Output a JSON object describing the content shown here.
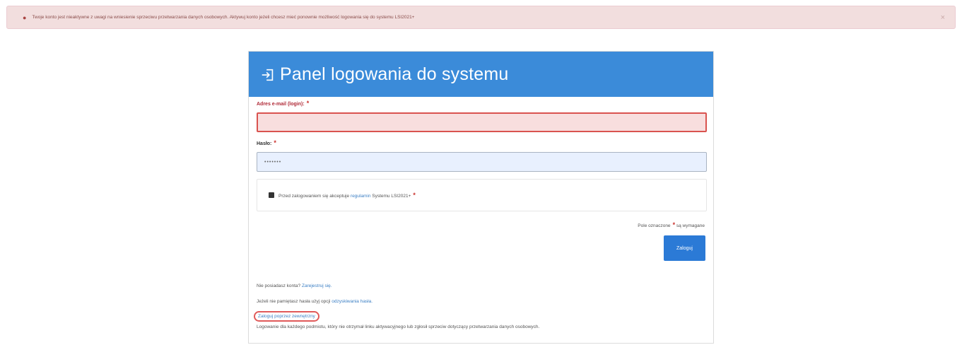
{
  "alert": {
    "message": "Twoje konto jest nieaktywne z uwagi na wniesienie sprzeciwu przetwarzania danych osobowych. Aktywuj konto jeżeli chcesz mieć ponownie możliwość logowania się do systemu LSI2021+",
    "close_symbol": "×"
  },
  "panel": {
    "title": "Panel logowania do systemu",
    "email": {
      "label": "Adres e-mail (login):",
      "value": ""
    },
    "password": {
      "label": "Hasło:",
      "value": "•••••••"
    },
    "consent": {
      "text_before": "Przed zalogowaniem się akceptuje",
      "link": "regulamin",
      "text_after": "Systemu LSI2021+"
    },
    "required_note": {
      "field": "Pole oznaczone",
      "text": "są wymagane"
    },
    "submit_label": "Zaloguj",
    "no_account": {
      "text": "Nie posiadasz konta?",
      "link": "Zarejestruj się."
    },
    "forgot": {
      "text": "Jeżeli nie pamiętasz hasła użyj opcji",
      "link": "odzyskiwania hasła."
    },
    "external_login": {
      "link": "Zaloguj poprzez zewnętrzny",
      "description": "Logowanie dla każdego podmiotu, który nie otrzymał linku aktywacyjnego lub zgłosił sprzeciw dotyczący przetwarzania danych osobowych."
    }
  }
}
